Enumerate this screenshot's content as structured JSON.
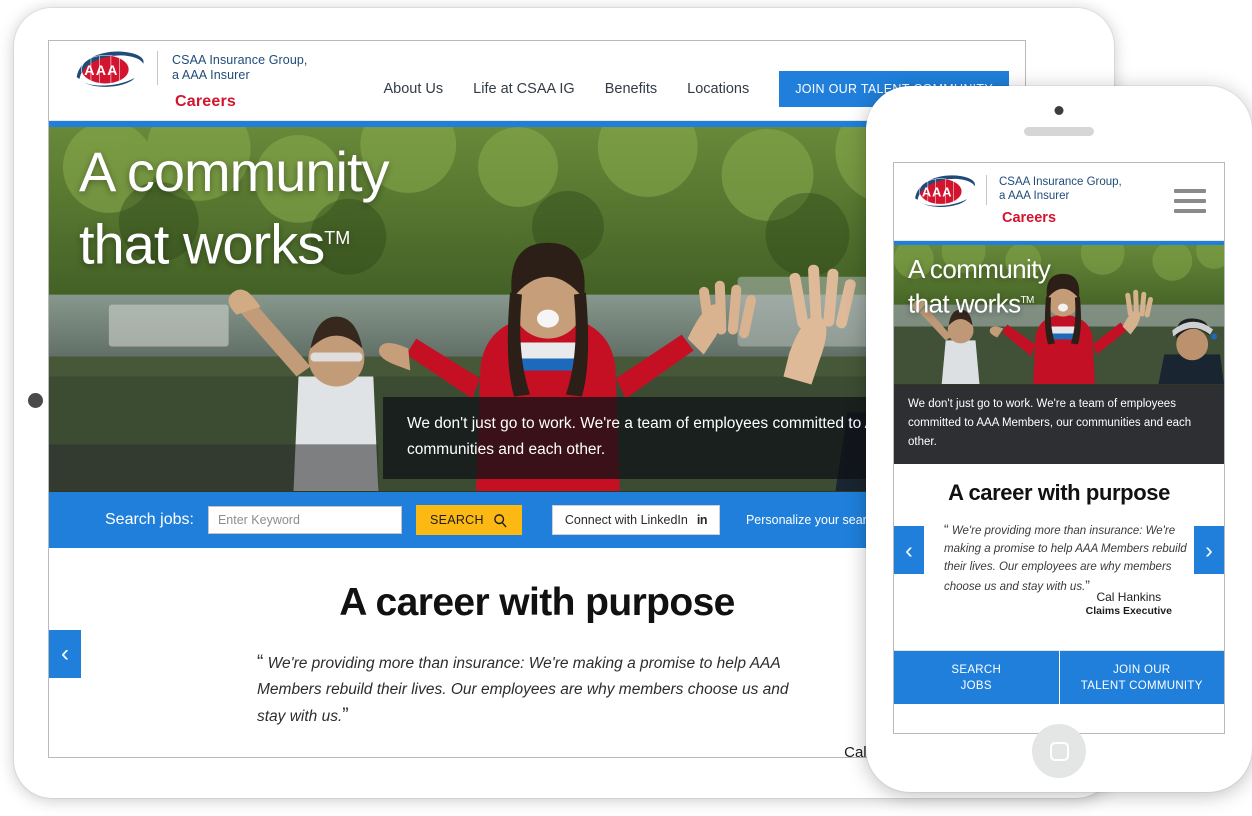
{
  "brand": {
    "logo_alt": "AAA",
    "company_line1": "CSAA Insurance Group,",
    "company_line2": "a AAA Insurer",
    "section_label": "Careers"
  },
  "colors": {
    "brand_blue": "#1f7fdb",
    "brand_red": "#d3142f",
    "navy_text": "#1f4b79",
    "search_yellow": "#fcb813",
    "linkedin_blue": "#0a66c2"
  },
  "desktop": {
    "nav": {
      "links": [
        {
          "label": "About Us"
        },
        {
          "label": "Life at CSAA IG"
        },
        {
          "label": "Benefits"
        },
        {
          "label": "Locations"
        }
      ],
      "cta_label": "JOIN OUR TALENT COMMUNITY"
    },
    "hero": {
      "title_line1": "A community",
      "title_line2": "that works",
      "trademark": "TM",
      "caption": "We don't just go to work. We're a team of employees committed to AAA Members, our communities and each other."
    },
    "search": {
      "label": "Search jobs:",
      "placeholder": "Enter Keyword",
      "value": "",
      "button_label": "SEARCH",
      "search_icon": "magnifier-icon",
      "linkedin_label": "Connect with LinkedIn",
      "linkedin_icon": "linkedin-icon",
      "personalize_note": "Personalize your search based"
    },
    "quote": {
      "heading": "A career with purpose",
      "open_quote": "“",
      "text": "We're providing more than insurance: We're making a promise to help AAA Members rebuild their lives. Our employees are why members choose us and stay with us.",
      "close_quote": "”",
      "author": "Cal Hankins",
      "prev_arrow": "‹"
    }
  },
  "mobile": {
    "menu_icon": "hamburger-menu-icon",
    "hero": {
      "title_line1": "A community",
      "title_line2": "that works",
      "trademark": "TM",
      "caption": "We don't just go to work. We're a team of employees committed to AAA Members, our communities and each other."
    },
    "quote": {
      "heading": "A career with purpose",
      "open_quote": "“",
      "text": "We're providing more than insurance: We're making a promise to help AAA Members rebuild their lives. Our employees are why members choose us and stay with us.",
      "close_quote": "”",
      "author": "Cal Hankins",
      "author_title": "Claims Executive",
      "prev_arrow": "‹",
      "next_arrow": "›"
    },
    "cta": [
      {
        "line1": "SEARCH",
        "line2": "JOBS"
      },
      {
        "line1": "JOIN OUR",
        "line2": "TALENT COMMUNITY"
      }
    ]
  }
}
